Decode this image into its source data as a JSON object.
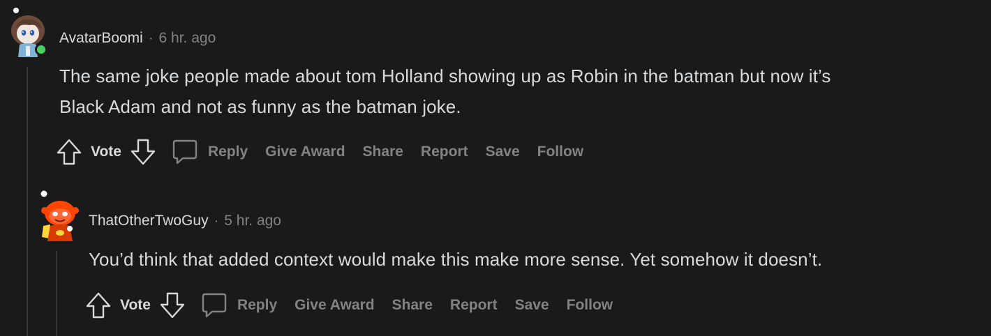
{
  "comments": [
    {
      "username": "AvatarBoomi",
      "separator": "·",
      "time": "6 hr. ago",
      "body_line1": "The same joke people made about tom Holland showing up as Robin in the batman but now it’s",
      "body_line2": "Black Adam and not as funny as the batman joke.",
      "actions": {
        "vote": "Vote",
        "reply": "Reply",
        "give_award": "Give Award",
        "share": "Share",
        "report": "Report",
        "save": "Save",
        "follow": "Follow"
      }
    },
    {
      "username": "ThatOtherTwoGuy",
      "separator": "·",
      "time": "5 hr. ago",
      "body_line1": "You’d think that added context would make this make more sense. Yet somehow it doesn’t.",
      "actions": {
        "vote": "Vote",
        "reply": "Reply",
        "give_award": "Give Award",
        "share": "Share",
        "report": "Report",
        "save": "Save",
        "follow": "Follow"
      }
    }
  ],
  "colors": {
    "background": "#1a1a1b",
    "text": "#d7dadc",
    "muted": "#818384",
    "thread_line": "#343536",
    "online": "#46d160"
  }
}
